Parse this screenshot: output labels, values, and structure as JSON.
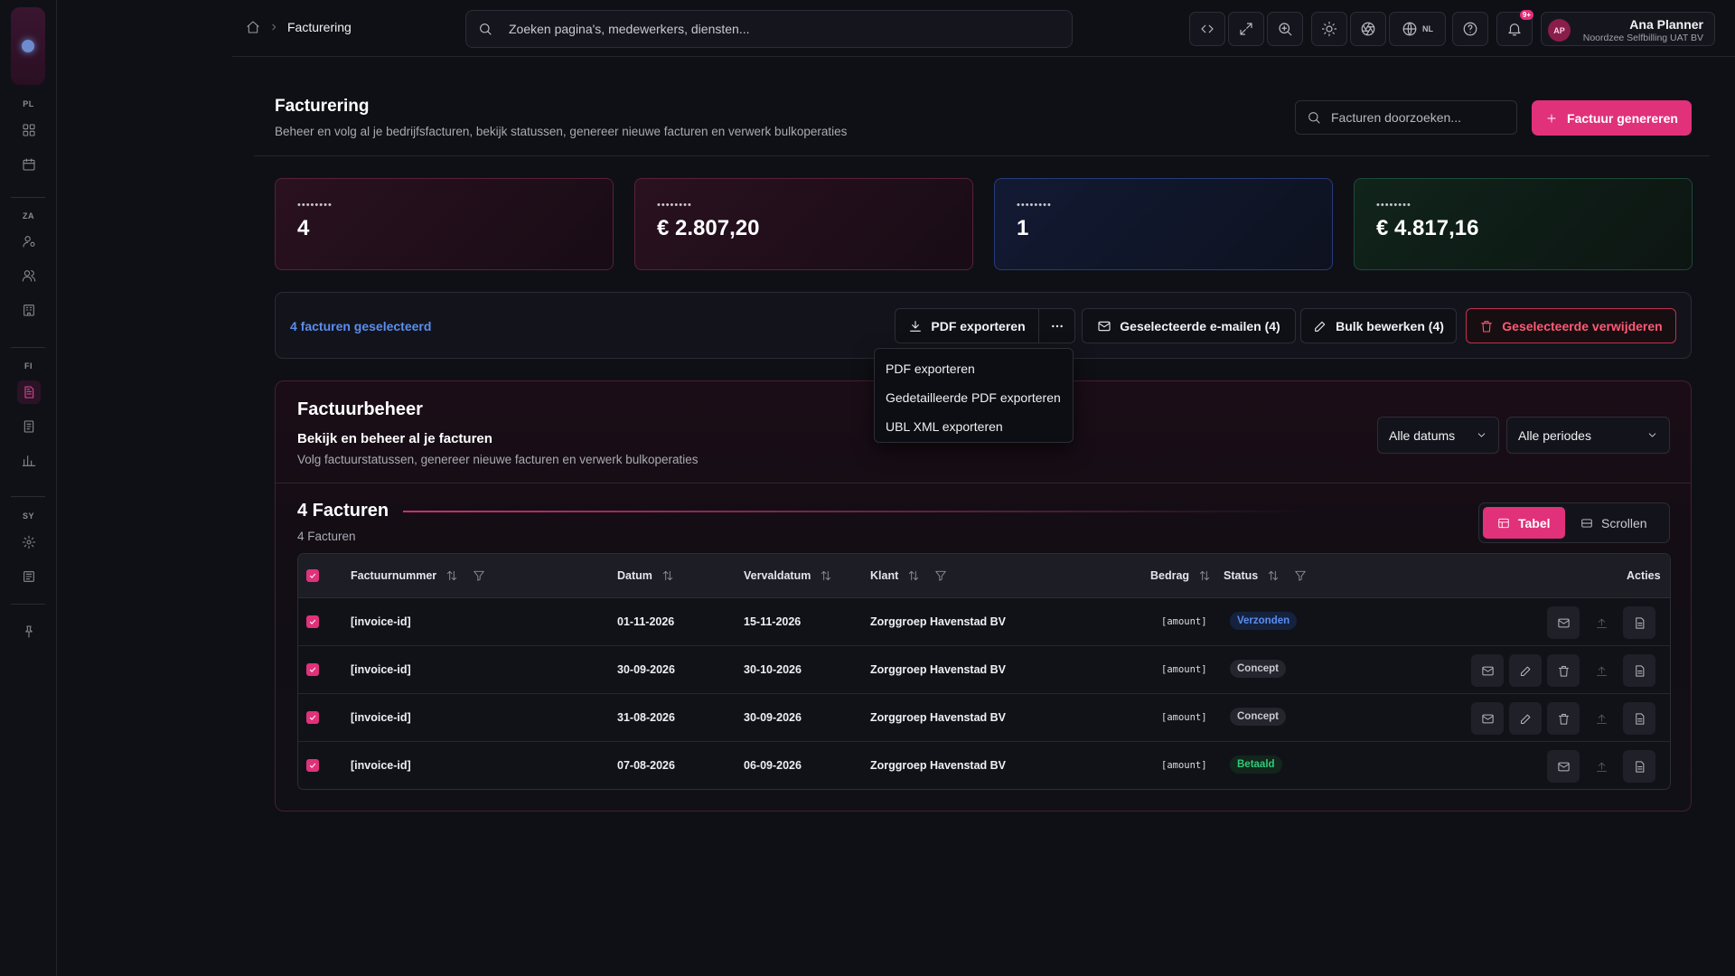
{
  "rail": {
    "sections": [
      "PL",
      "ZA",
      "FI",
      "SY"
    ]
  },
  "topbar": {
    "breadcrumb_current": "Facturering",
    "search_placeholder": "Zoeken pagina's, medewerkers, diensten...",
    "language": "NL",
    "notifications_badge": "9+",
    "user": {
      "initials": "AP",
      "name": "Ana Planner",
      "org": "Noordzee Selfbilling UAT BV"
    }
  },
  "header": {
    "title": "Facturering",
    "subtitle": "Beheer en volg al je bedrijfsfacturen, bekijk statussen, genereer nieuwe facturen en verwerk bulkoperaties",
    "search_placeholder": "Facturen doorzoeken...",
    "generate_label": "Factuur genereren"
  },
  "stats": [
    {
      "label": "••••••••",
      "value": "4"
    },
    {
      "label": "••••••••",
      "value": "€ 2.807,20"
    },
    {
      "label": "••••••••",
      "value": "1"
    },
    {
      "label": "••••••••",
      "value": "€ 4.817,16"
    }
  ],
  "bulk": {
    "selected_text": "4 facturen geselecteerd",
    "pdf_export": "PDF exporteren",
    "email_selected": "Geselecteerde e-mailen (4)",
    "bulk_edit": "Bulk bewerken (4)",
    "delete_selected": "Geselecteerde verwijderen"
  },
  "export_menu": [
    "PDF exporteren",
    "Gedetailleerde PDF exporteren",
    "UBL XML exporteren"
  ],
  "panel": {
    "title": "Factuurbeheer",
    "subtitle": "Bekijk en beheer al je facturen",
    "description": "Volg factuurstatussen, genereer nieuwe facturen en verwerk bulkoperaties",
    "date_filter": "Alle datums",
    "period_filter": "Alle periodes",
    "count_title": "4 Facturen",
    "count_sub": "4 Facturen",
    "view_table": "Tabel",
    "view_scroll": "Scrollen"
  },
  "table": {
    "columns": {
      "invoice": "Factuurnummer",
      "date": "Datum",
      "due": "Vervaldatum",
      "client": "Klant",
      "amount": "Bedrag",
      "status": "Status",
      "actions": "Acties"
    },
    "rows": [
      {
        "invoice": "[invoice-id]",
        "date": "01-11-2026",
        "due": "15-11-2026",
        "client": "Zorggroep Havenstad BV",
        "amount": "[amount]",
        "status": "Verzonden"
      },
      {
        "invoice": "[invoice-id]",
        "date": "30-09-2026",
        "due": "30-10-2026",
        "client": "Zorggroep Havenstad BV",
        "amount": "[amount]",
        "status": "Concept"
      },
      {
        "invoice": "[invoice-id]",
        "date": "31-08-2026",
        "due": "30-09-2026",
        "client": "Zorggroep Havenstad BV",
        "amount": "[amount]",
        "status": "Concept"
      },
      {
        "invoice": "[invoice-id]",
        "date": "07-08-2026",
        "due": "06-09-2026",
        "client": "Zorggroep Havenstad BV",
        "amount": "[amount]",
        "status": "Betaald"
      }
    ]
  },
  "colors": {
    "accent": "#e1317a",
    "status_sent": "#5b8def",
    "status_draft": "#c9c9d0",
    "status_paid": "#34c77b"
  }
}
